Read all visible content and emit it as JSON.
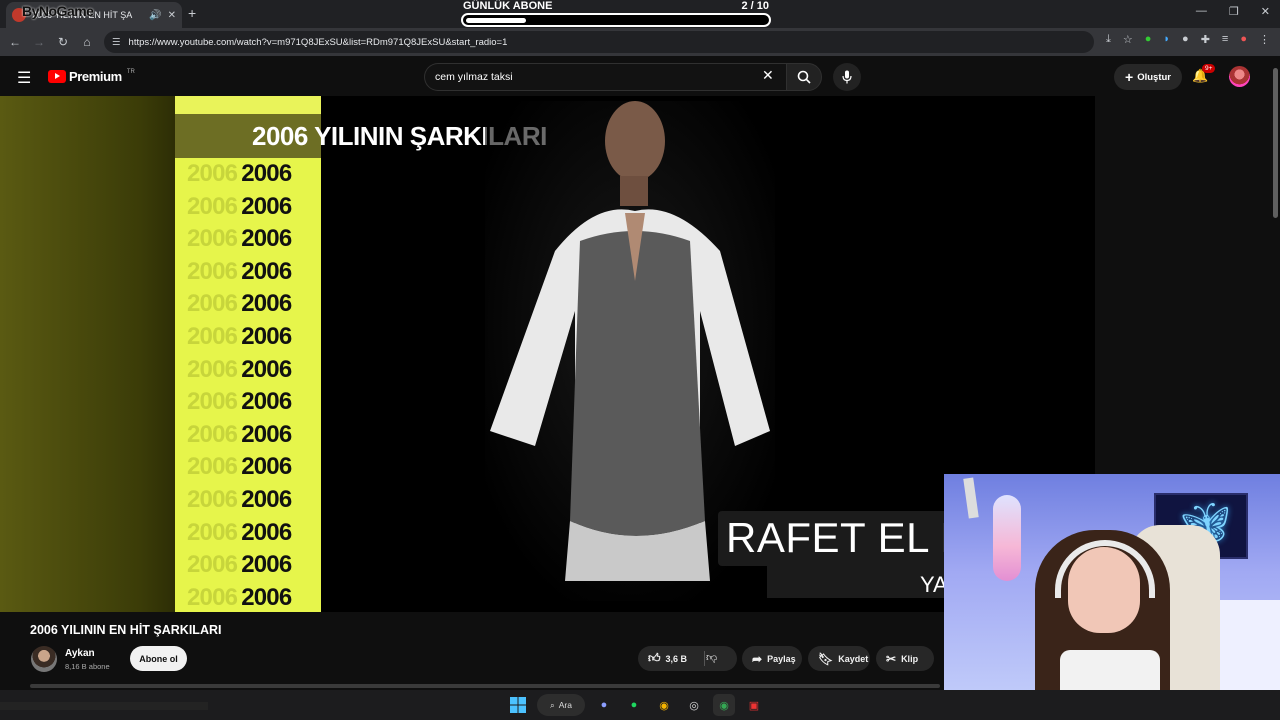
{
  "browser": {
    "tab_title": "2006 YILININ EN HİT ŞA",
    "tab_overlay_logo": "ByNoGame",
    "url": "https://www.youtube.com/watch?v=m971Q8JExSU&list=RDm971Q8JExSU&start_radio=1"
  },
  "stream_overlay": {
    "goal_label": "GÜNLÜK ABONE",
    "goal_count": "2 / 10",
    "goal_progress": 0.2
  },
  "youtube": {
    "logo_text": "Premium",
    "region": "TR",
    "search_value": "cem yılmaz taksi",
    "create_label": "Oluştur",
    "notif_badge": "9+"
  },
  "video": {
    "overlay_title": "2006 YILININ ŞARKILARI",
    "years": [
      "2006",
      "2006",
      "2006",
      "2006",
      "2006",
      "2006",
      "2006",
      "2006",
      "2006",
      "2006",
      "2006",
      "2006",
      "2006",
      "2006"
    ],
    "ghost_year": "2006",
    "name_lower_third": "RAFET EL RO",
    "name_second_line": "YA",
    "page_title": "2006 YILININ EN HİT ŞARKILARI"
  },
  "channel": {
    "name": "Aykan",
    "subs": "8,16 B abone",
    "subscribe_label": "Abone ol"
  },
  "actions": {
    "likes": "3,6 B",
    "share": "Paylaş",
    "save": "Kaydet",
    "clip": "Klip"
  },
  "taskbar": {
    "search_label": "Ara"
  },
  "colors": {
    "youtube_red": "#ff0000",
    "year_panel": "#e6f54b",
    "page_bg": "#0f0f0f"
  }
}
